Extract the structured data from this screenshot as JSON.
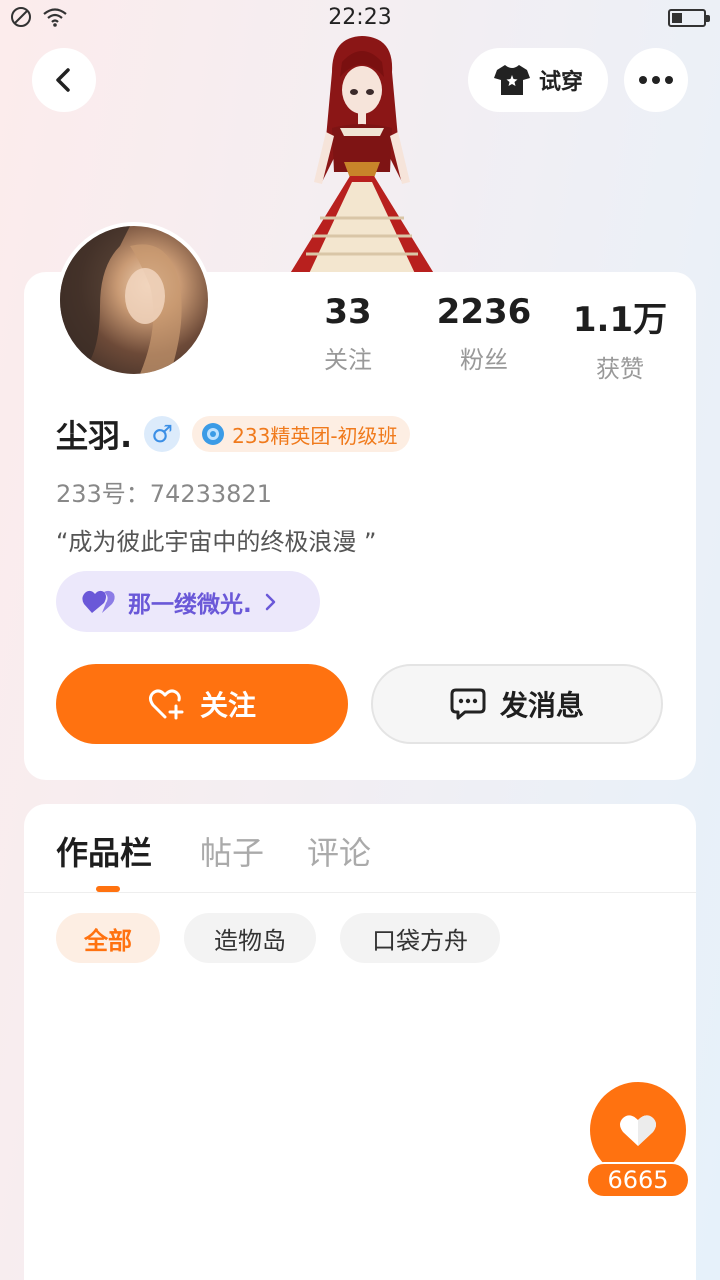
{
  "status_bar": {
    "time": "22:23"
  },
  "header": {
    "try_on_label": "试穿"
  },
  "profile": {
    "username": "尘羽.",
    "gender_symbol": "♂",
    "badge": "233精英团-初级班",
    "uid_label": "233号：74233821",
    "bio": "“成为彼此宇宙中的终极浪漫 ”",
    "stats": [
      {
        "value": "33",
        "label": "关注"
      },
      {
        "value": "2236",
        "label": "粉丝"
      },
      {
        "value": "1.1万",
        "label": "获赞"
      }
    ],
    "group_chip": "那一缕微光."
  },
  "actions": {
    "follow_label": "关注",
    "message_label": "发消息"
  },
  "tabs": [
    {
      "label": "作品栏",
      "active": true
    },
    {
      "label": "帖子",
      "active": false
    },
    {
      "label": "评论",
      "active": false
    }
  ],
  "filters": [
    {
      "label": "全部",
      "active": true
    },
    {
      "label": "造物岛",
      "active": false
    },
    {
      "label": "口袋方舟",
      "active": false
    }
  ],
  "like_fab": {
    "count": "6665"
  },
  "colors": {
    "accent": "#ff7210",
    "group_purple": "#6a58d8",
    "gender_blue": "#3b8fe6"
  }
}
